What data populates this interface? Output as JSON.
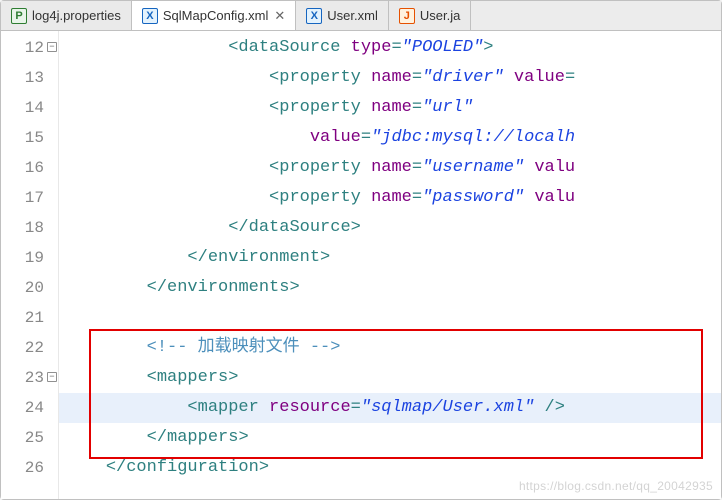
{
  "tabs": [
    {
      "icon": "P",
      "iconClass": "p",
      "label": "log4j.properties"
    },
    {
      "icon": "X",
      "iconClass": "x",
      "label": "SqlMapConfig.xml",
      "active": true
    },
    {
      "icon": "X",
      "iconClass": "x",
      "label": "User.xml"
    },
    {
      "icon": "J",
      "iconClass": "j",
      "label": "User.ja"
    }
  ],
  "close_glyph": "✕",
  "fold_minus": "−",
  "gutter": [
    "12",
    "13",
    "14",
    "15",
    "16",
    "17",
    "18",
    "19",
    "20",
    "21",
    "22",
    "23",
    "24",
    "25",
    "26"
  ],
  "code": {
    "l12a": "                ",
    "l12_tag_open": "<dataSource",
    "l12_sp": " ",
    "l12_attr": "type",
    "l12_eq": "=",
    "l12_q": "\"",
    "l12_val": "POOLED",
    "l12_tag_close": ">",
    "l13a": "                    ",
    "l13_tag_open": "<property",
    "l13_sp": " ",
    "l13_attr1": "name",
    "l13_eq": "=",
    "l13_q": "\"",
    "l13_val1": "driver",
    "l13_sp2": " ",
    "l13_attr2": "value",
    "l13_eq2": "=",
    "l14a": "                    ",
    "l14_tag_open": "<property",
    "l14_attr1": "name",
    "l14_val1": "url",
    "l15a": "                        ",
    "l15_attr": "value",
    "l15_val": "jdbc:mysql://localh",
    "l16a": "                    ",
    "l16_tag_open": "<property",
    "l16_attr1": "name",
    "l16_val1": "username",
    "l16_attr2": "valu",
    "l17a": "                    ",
    "l17_tag_open": "<property",
    "l17_attr1": "name",
    "l17_val1": "password",
    "l17_attr2": "valu",
    "l18a": "                ",
    "l18_close": "</dataSource>",
    "l19a": "            ",
    "l19_close": "</environment>",
    "l20a": "        ",
    "l20_close": "</environments>",
    "l21": "",
    "l22a": "        ",
    "l22_comment": "<!-- 加载映射文件 -->",
    "l23a": "        ",
    "l23_open": "<mappers>",
    "l24a": "            ",
    "l24_open": "<mapper",
    "l24_attr": "resource",
    "l24_val": "sqlmap/User.xml",
    "l24_close": " />",
    "l25a": "        ",
    "l25_close": "</mappers>",
    "l26a": "    ",
    "l26_close": "</configuration>"
  },
  "watermark": "https://blog.csdn.net/qq_20042935"
}
